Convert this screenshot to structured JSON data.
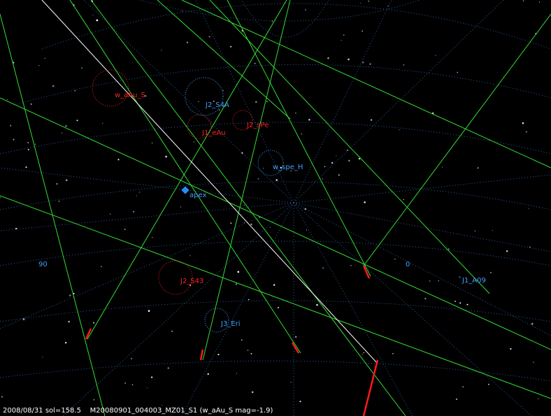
{
  "colors": {
    "background": "#000000",
    "grid": "#2a5fa8",
    "meteor_track": "#33dd33",
    "meteor_head": "#ff1a1a",
    "highlight_track": "#ffffff",
    "shower_red": "#ff2020",
    "shower_blue": "#3ea0ff",
    "apex": "#1e90ff",
    "status_text": "#ffffff"
  },
  "radiants_red": [
    {
      "label": "w_aAu_S"
    },
    {
      "label": "J1_eAu"
    },
    {
      "label": "J2_sPe"
    },
    {
      "label": "J2_S43"
    }
  ],
  "radiants_blue": [
    {
      "label": "J2_S4A"
    },
    {
      "label": "w_spe_H"
    },
    {
      "label": "J3_Eri"
    },
    {
      "label": "J1_A09"
    }
  ],
  "apex": {
    "label": "apex",
    "icon": "diamond-icon"
  },
  "grid_labels": {
    "left": "90",
    "right": "0"
  },
  "status": {
    "date": "2008/08/31",
    "sol": "sol=158.5",
    "file": "M20080901_004003_MZ01_S1",
    "info": "(w_aAu_S mag=-1.9)"
  }
}
